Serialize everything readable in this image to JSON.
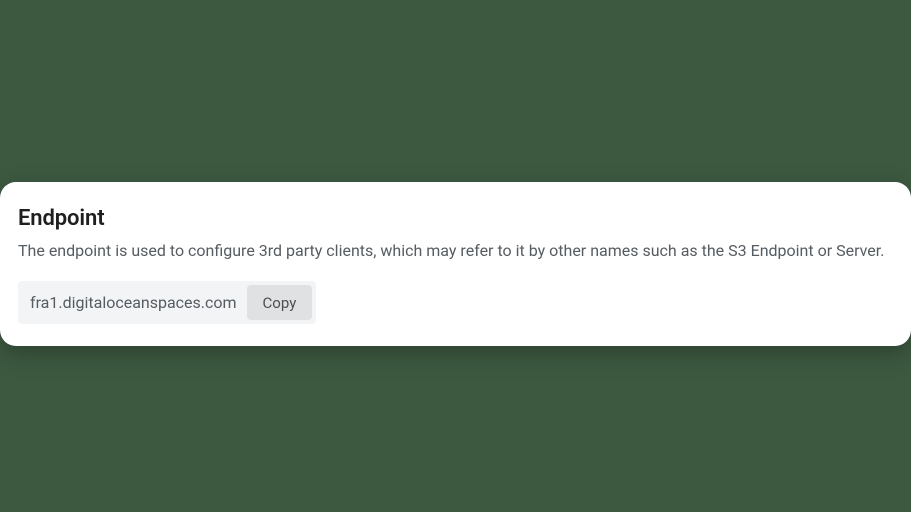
{
  "endpoint": {
    "title": "Endpoint",
    "description": "The endpoint is used to configure 3rd party clients, which may refer to it by other names such as the S3 Endpoint or Server.",
    "value": "fra1.digitaloceanspaces.com",
    "copy_label": "Copy"
  }
}
